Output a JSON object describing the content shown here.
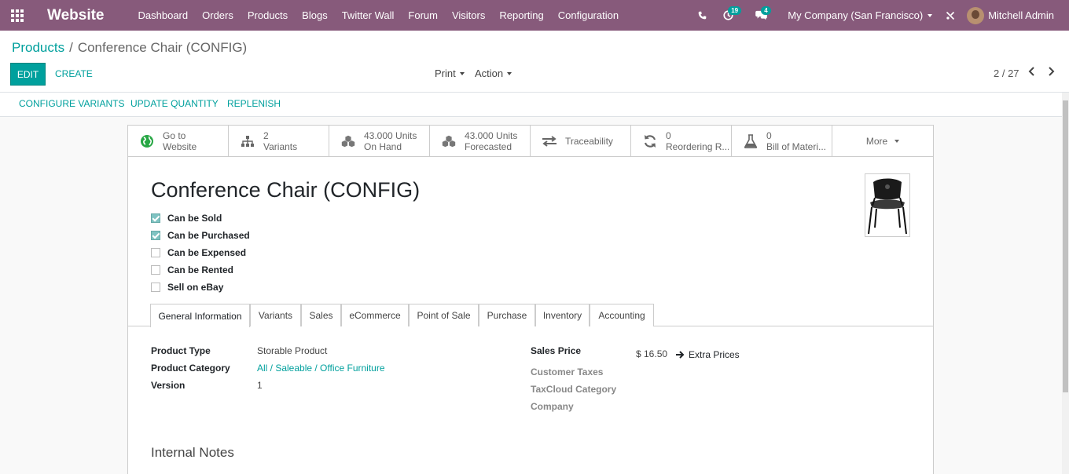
{
  "navbar": {
    "brand": "Website",
    "menu": [
      "Dashboard",
      "Orders",
      "Products",
      "Blogs",
      "Twitter Wall",
      "Forum",
      "Visitors",
      "Reporting",
      "Configuration"
    ],
    "activity_badge": "19",
    "messages_badge": "4",
    "company": "My Company (San Francisco)",
    "user": "Mitchell Admin"
  },
  "breadcrumb": {
    "parent": "Products",
    "separator": "/",
    "current": "Conference Chair (CONFIG)"
  },
  "buttons": {
    "edit": "EDIT",
    "create": "CREATE",
    "print": "Print",
    "action": "Action"
  },
  "pager": "2 / 27",
  "header_buttons": [
    "CONFIGURE VARIANTS",
    "UPDATE QUANTITY",
    "REPLENISH"
  ],
  "smart_buttons": [
    {
      "line1": "Go to",
      "line2": "Website",
      "icon": "globe-icon"
    },
    {
      "line1": "2",
      "line2": "Variants",
      "icon": "sitemap-icon"
    },
    {
      "line1": "43.000 Units",
      "line2": "On Hand",
      "icon": "cubes-icon"
    },
    {
      "line1": "43.000 Units",
      "line2": "Forecasted",
      "icon": "cubes-icon"
    },
    {
      "line1": "Traceability",
      "line2": "",
      "icon": "exchange-icon"
    },
    {
      "line1": "0",
      "line2": "Reordering R...",
      "icon": "refresh-icon"
    },
    {
      "line1": "0",
      "line2": "Bill of Materi...",
      "icon": "flask-icon"
    }
  ],
  "more_label": "More",
  "product": {
    "name": "Conference Chair (CONFIG)",
    "checkboxes": [
      {
        "label": "Can be Sold",
        "checked": true
      },
      {
        "label": "Can be Purchased",
        "checked": true
      },
      {
        "label": "Can be Expensed",
        "checked": false
      },
      {
        "label": "Can be Rented",
        "checked": false
      },
      {
        "label": "Sell on eBay",
        "checked": false
      }
    ]
  },
  "tabs": [
    "General Information",
    "Variants",
    "Sales",
    "eCommerce",
    "Point of Sale",
    "Purchase",
    "Inventory",
    "Accounting"
  ],
  "general": {
    "product_type_label": "Product Type",
    "product_type": "Storable Product",
    "product_category_label": "Product Category",
    "product_category": "All / Saleable / Office Furniture",
    "version_label": "Version",
    "version": "1",
    "sales_price_label": "Sales Price",
    "sales_price": "$ 16.50",
    "extra_prices": "Extra Prices",
    "customer_taxes_label": "Customer Taxes",
    "taxcloud_label": "TaxCloud Category",
    "company_label": "Company"
  },
  "internal_notes": "Internal Notes",
  "colors": {
    "navbar": "#875a7b",
    "accent": "#00a09d"
  }
}
